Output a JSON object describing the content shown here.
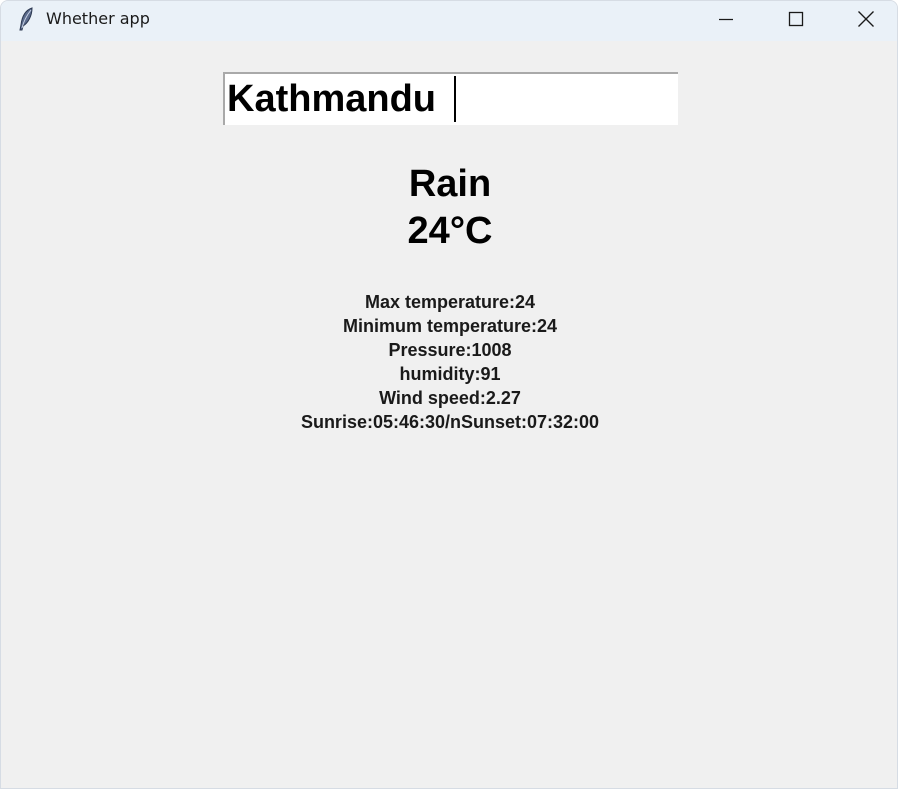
{
  "window": {
    "title": "Whether app",
    "icon": "feather-icon",
    "controls": [
      "minimize-icon",
      "maximize-icon",
      "close-icon"
    ]
  },
  "search": {
    "value": "Kathmandu"
  },
  "weather": {
    "condition": "Rain",
    "temperature": "24°C"
  },
  "details": {
    "max_temp": "Max temperature:24",
    "min_temp": "Minimum temperature:24",
    "pressure": "Pressure:1008",
    "humidity": "humidity:91",
    "wind_speed": "Wind speed:2.27",
    "sun_times": "Sunrise:05:46:30/nSunset:07:32:00"
  }
}
